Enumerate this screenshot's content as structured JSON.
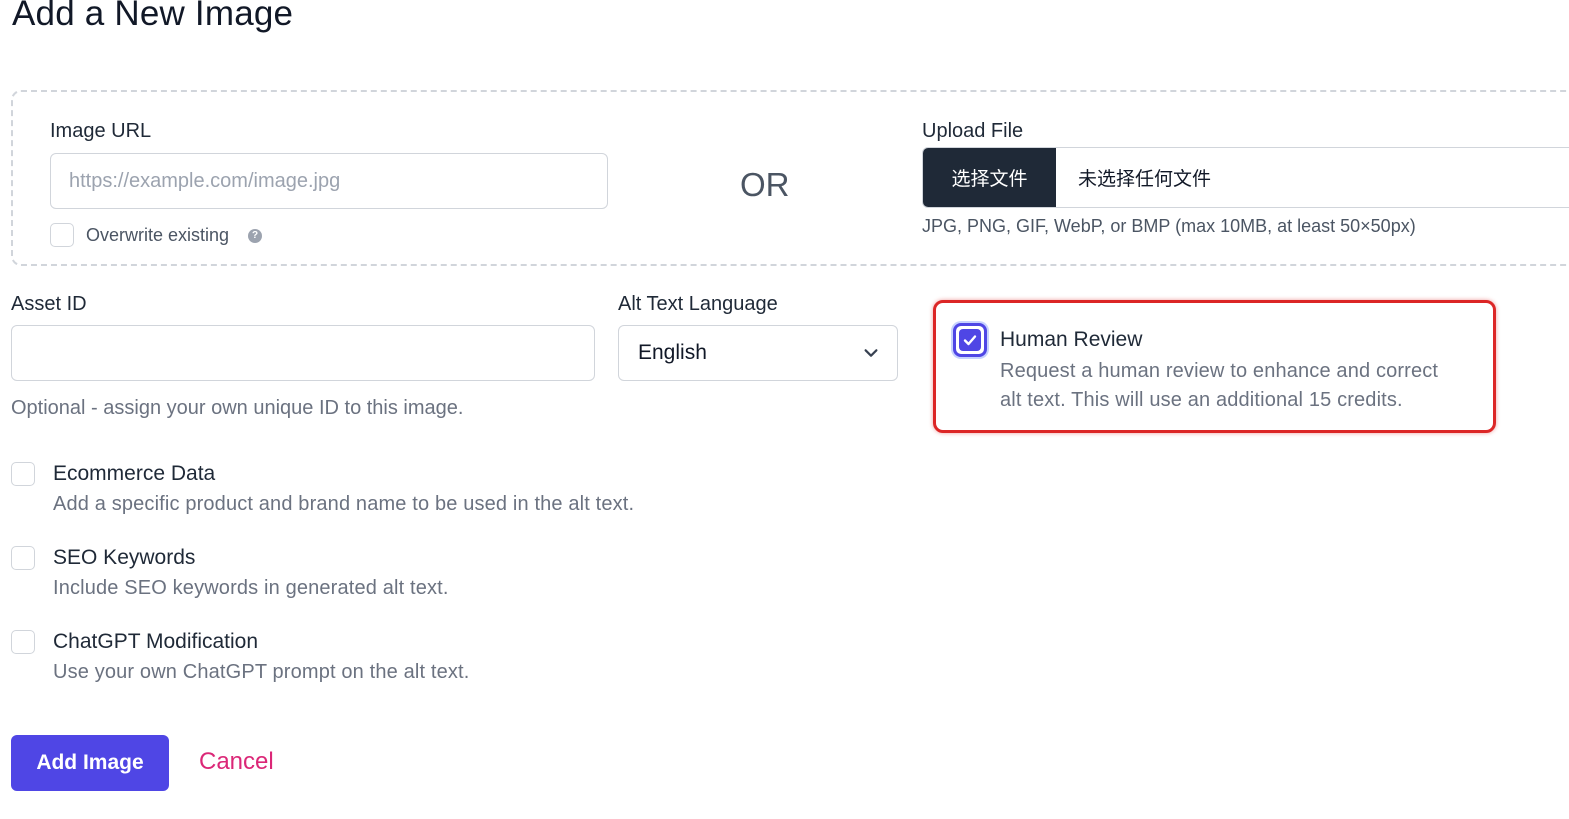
{
  "page": {
    "title": "Add a New Image"
  },
  "image_url": {
    "label": "Image URL",
    "placeholder": "https://example.com/image.jpg",
    "value": "",
    "overwrite_label": "Overwrite existing",
    "overwrite_checked": false,
    "help_icon_name": "question-circle-icon",
    "help_icon_glyph": "?"
  },
  "separator": {
    "or_text": "OR"
  },
  "upload": {
    "label": "Upload File",
    "choose_button": "选择文件",
    "status": "未选择任何文件",
    "hint": "JPG, PNG, GIF, WebP, or BMP (max 10MB, at least 50×50px)"
  },
  "asset_id": {
    "label": "Asset ID",
    "value": "",
    "help": "Optional - assign your own unique ID to this image."
  },
  "alt_language": {
    "label": "Alt Text Language",
    "selected": "English",
    "chevron_icon": "chevron-down-icon"
  },
  "options": {
    "human_review": {
      "title": "Human Review",
      "desc_line1": "Request a human review to enhance and correct",
      "desc_line2": "alt text. This will use an additional 15 credits.",
      "checked": true
    },
    "ecommerce": {
      "title": "Ecommerce Data",
      "desc": "Add a specific product and brand name to be used in the alt text.",
      "checked": false
    },
    "seo": {
      "title": "SEO Keywords",
      "desc": "Include SEO keywords in generated alt text.",
      "checked": false
    },
    "chatgpt": {
      "title": "ChatGPT Modification",
      "desc": "Use your own ChatGPT prompt on the alt text.",
      "checked": false
    }
  },
  "actions": {
    "submit": "Add Image",
    "cancel": "Cancel"
  },
  "colors": {
    "primary": "#4f46e5",
    "cancel_link": "#db2777",
    "highlight_outline": "#dc2626",
    "file_button_bg": "#1f2937"
  }
}
